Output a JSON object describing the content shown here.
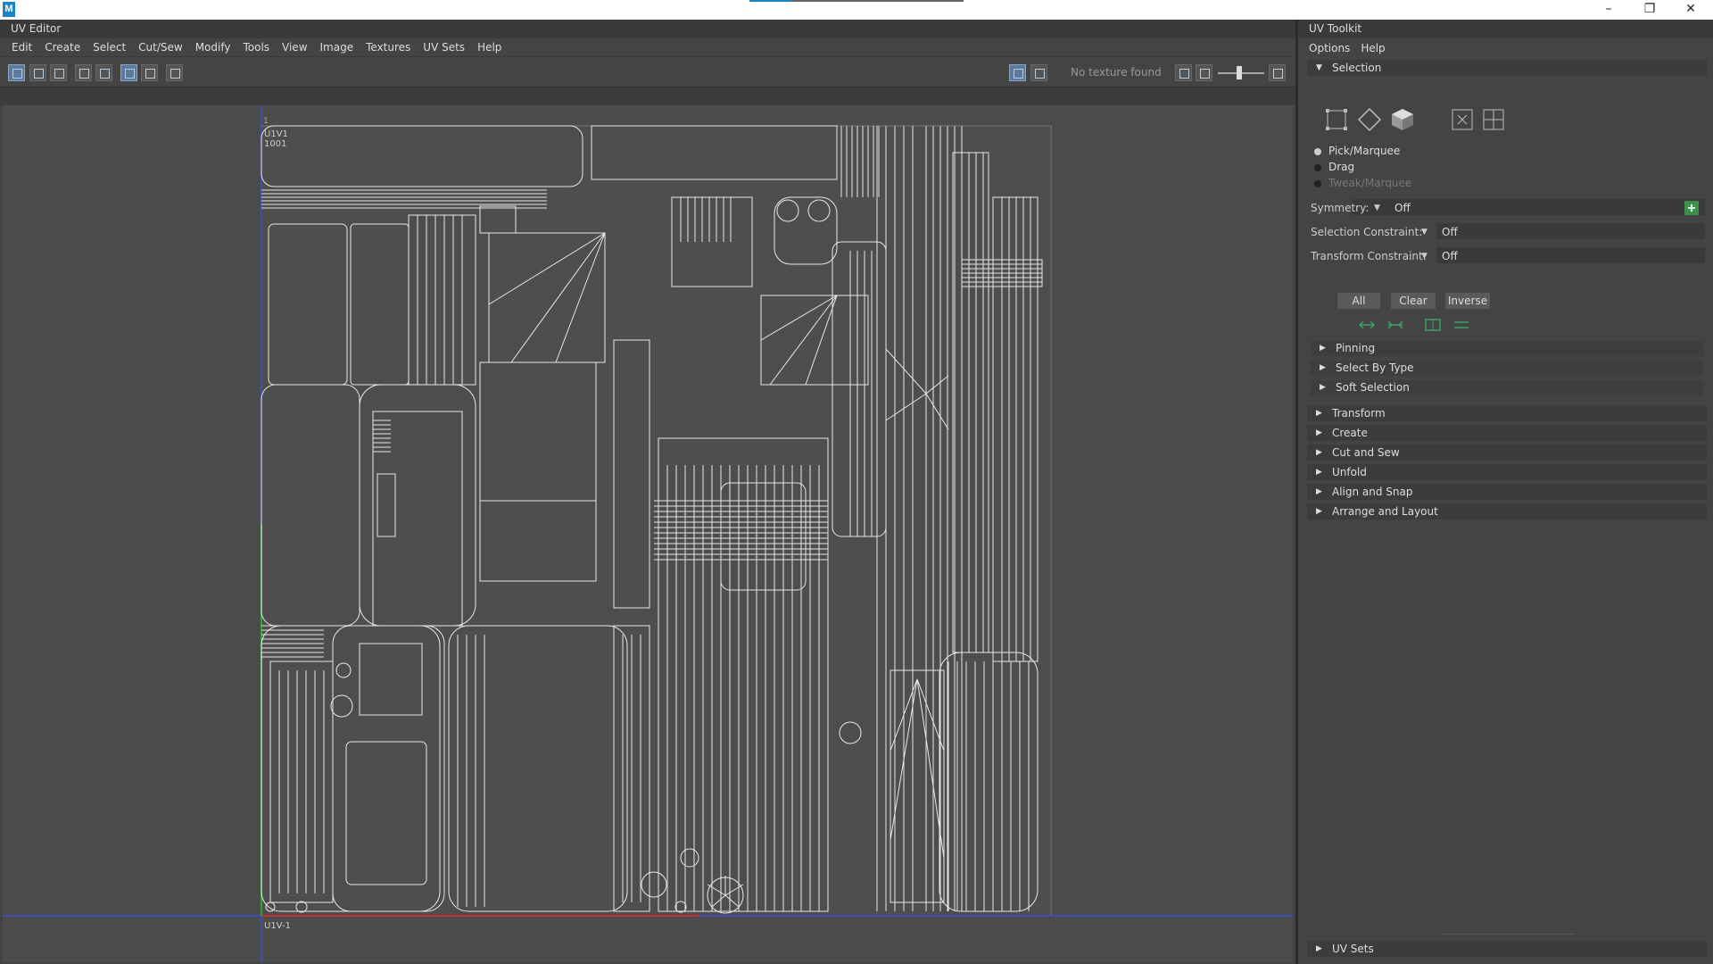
{
  "os": {
    "app_icon": "M",
    "minimize": "–",
    "restore": "❐",
    "close": "✕"
  },
  "uv_editor": {
    "title": "UV Editor",
    "menu": [
      "Edit",
      "Create",
      "Select",
      "Cut/Sew",
      "Modify",
      "Tools",
      "View",
      "Image",
      "Textures",
      "UV Sets",
      "Help"
    ],
    "texture_status": "No texture found",
    "tile_label_top_1": "U1V1",
    "tile_label_top_2": "1001",
    "tile_label_bottom": "U1V-1",
    "ruler_mark": "1"
  },
  "toolkit": {
    "title": "UV Toolkit",
    "menu": [
      "Options",
      "Help"
    ],
    "selection": {
      "header": "Selection",
      "modes": [
        {
          "label": "Pick/Marquee",
          "state": "on"
        },
        {
          "label": "Drag",
          "state": "off"
        },
        {
          "label": "Tweak/Marquee",
          "state": "disabled"
        }
      ],
      "symmetry_label": "Symmetry:",
      "symmetry_value": "Off",
      "selection_constraint_label": "Selection Constraint:",
      "selection_constraint_value": "Off",
      "transform_constraint_label": "Transform Constraint:",
      "transform_constraint_value": "Off",
      "buttons": [
        "All",
        "Clear",
        "Inverse"
      ],
      "subsections": [
        "Pinning",
        "Select By Type",
        "Soft Selection"
      ]
    },
    "sections": [
      "Transform",
      "Create",
      "Cut and Sew",
      "Unfold",
      "Align and Snap",
      "Arrange and Layout"
    ],
    "bottom_section": "UV Sets"
  }
}
